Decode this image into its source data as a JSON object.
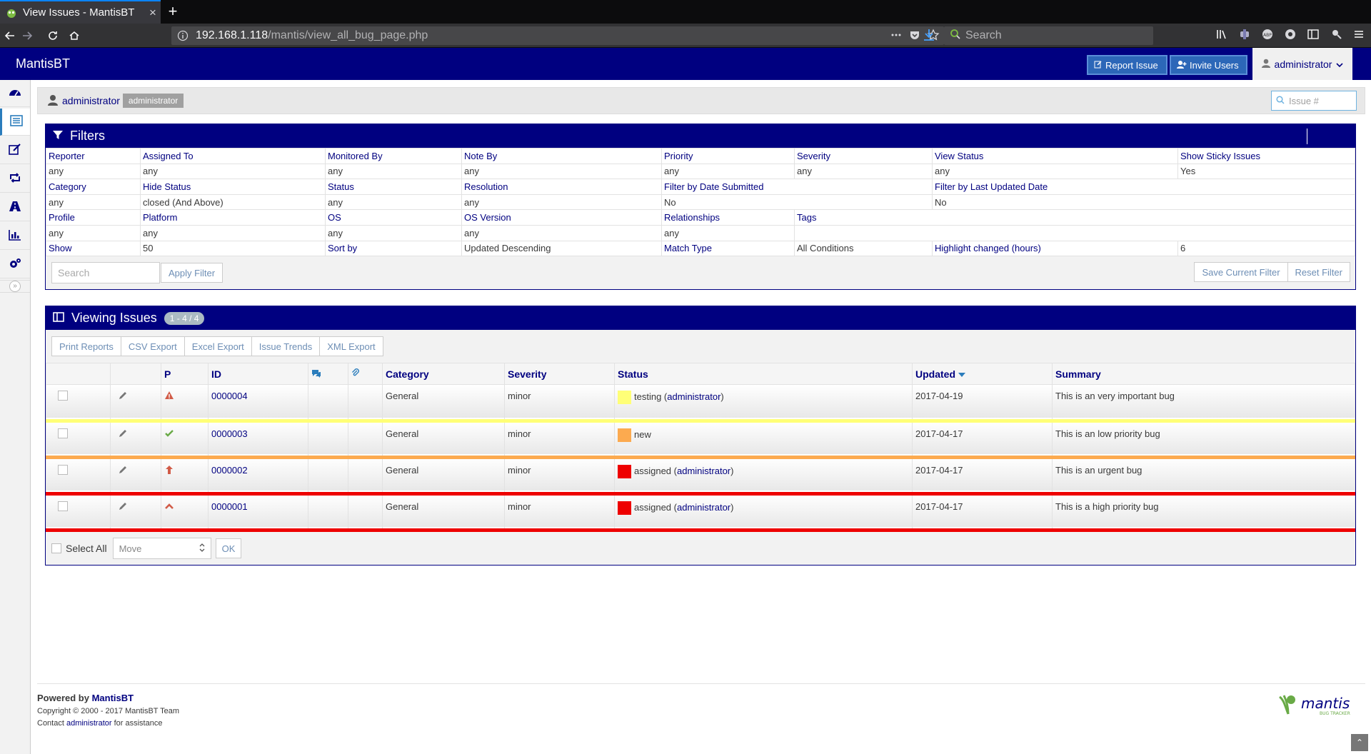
{
  "browser": {
    "tab_title": "View Issues - MantisBT",
    "url_host": "192.168.1.118",
    "url_path": "/mantis/view_all_bug_page.php",
    "search_placeholder": "Search",
    "new_tab": "+",
    "close_tab": "×"
  },
  "nav": {
    "brand": "MantisBT",
    "report_issue": "Report Issue",
    "invite_users": "Invite Users",
    "user": "administrator"
  },
  "breadcrumb": {
    "user": "administrator",
    "role": "administrator",
    "issue_placeholder": "Issue #"
  },
  "filters": {
    "title": "Filters",
    "rows": [
      [
        {
          "t": "Reporter",
          "k": "lbl",
          "c": 1
        },
        {
          "t": "Assigned To",
          "k": "lbl",
          "c": 1
        },
        {
          "t": "Monitored By",
          "k": "lbl",
          "c": 1
        },
        {
          "t": "Note By",
          "k": "lbl",
          "c": 1
        },
        {
          "t": "Priority",
          "k": "lbl",
          "c": 1
        },
        {
          "t": "Severity",
          "k": "lbl",
          "c": 1
        },
        {
          "t": "View Status",
          "k": "lbl",
          "c": 1
        },
        {
          "t": "Show Sticky Issues",
          "k": "lbl",
          "c": 1
        }
      ],
      [
        {
          "t": "any",
          "k": "val",
          "c": 1
        },
        {
          "t": "any",
          "k": "val",
          "c": 1
        },
        {
          "t": "any",
          "k": "val",
          "c": 1
        },
        {
          "t": "any",
          "k": "val",
          "c": 1
        },
        {
          "t": "any",
          "k": "val",
          "c": 1
        },
        {
          "t": "any",
          "k": "val",
          "c": 1
        },
        {
          "t": "any",
          "k": "val",
          "c": 1
        },
        {
          "t": "Yes",
          "k": "val",
          "c": 1
        }
      ],
      [
        {
          "t": "Category",
          "k": "lbl",
          "c": 1
        },
        {
          "t": "Hide Status",
          "k": "lbl",
          "c": 1
        },
        {
          "t": "Status",
          "k": "lbl",
          "c": 1
        },
        {
          "t": "Resolution",
          "k": "lbl",
          "c": 1
        },
        {
          "t": "Filter by Date Submitted",
          "k": "lbl",
          "c": 2
        },
        {
          "t": "Filter by Last Updated Date",
          "k": "lbl",
          "c": 2
        }
      ],
      [
        {
          "t": "any",
          "k": "val",
          "c": 1
        },
        {
          "t": "closed (And Above)",
          "k": "val",
          "c": 1
        },
        {
          "t": "any",
          "k": "val",
          "c": 1
        },
        {
          "t": "any",
          "k": "val",
          "c": 1
        },
        {
          "t": "No",
          "k": "val",
          "c": 2
        },
        {
          "t": "No",
          "k": "val",
          "c": 2
        }
      ],
      [
        {
          "t": "Profile",
          "k": "lbl",
          "c": 1
        },
        {
          "t": "Platform",
          "k": "lbl",
          "c": 1
        },
        {
          "t": "OS",
          "k": "lbl",
          "c": 1
        },
        {
          "t": "OS Version",
          "k": "lbl",
          "c": 1
        },
        {
          "t": "Relationships",
          "k": "lbl",
          "c": 1
        },
        {
          "t": "Tags",
          "k": "lbl",
          "c": 3
        }
      ],
      [
        {
          "t": "any",
          "k": "val",
          "c": 1
        },
        {
          "t": "any",
          "k": "val",
          "c": 1
        },
        {
          "t": "any",
          "k": "val",
          "c": 1
        },
        {
          "t": "any",
          "k": "val",
          "c": 1
        },
        {
          "t": "any",
          "k": "val",
          "c": 1
        },
        {
          "t": "",
          "k": "val",
          "c": 3
        }
      ],
      [
        {
          "t": "Show",
          "k": "lbl",
          "c": 1
        },
        {
          "t": "50",
          "k": "val",
          "c": 1
        },
        {
          "t": "Sort by",
          "k": "lbl",
          "c": 1
        },
        {
          "t": "Updated Descending",
          "k": "val",
          "c": 1
        },
        {
          "t": "Match Type",
          "k": "lbl",
          "c": 1
        },
        {
          "t": "All Conditions",
          "k": "val",
          "c": 1
        },
        {
          "t": "Highlight changed (hours)",
          "k": "lbl",
          "c": 1
        },
        {
          "t": "6",
          "k": "val",
          "c": 1
        }
      ]
    ],
    "search_placeholder": "Search",
    "apply": "Apply Filter",
    "save": "Save Current Filter",
    "reset": "Reset Filter"
  },
  "issues": {
    "title": "Viewing Issues",
    "count": "1 - 4 / 4",
    "exports": [
      "Print Reports",
      "CSV Export",
      "Excel Export",
      "Issue Trends",
      "XML Export"
    ],
    "columns": {
      "priority": "P",
      "id": "ID",
      "category": "Category",
      "severity": "Severity",
      "status": "Status",
      "updated": "Updated",
      "summary": "Summary"
    },
    "rows": [
      {
        "id": "0000004",
        "priority_icon": "warning-icon",
        "priority_color": "#d15b47",
        "category": "General",
        "severity": "minor",
        "status": "testing",
        "handler": "administrator",
        "status_color": "#ffff77",
        "updated": "2017-04-19",
        "summary": "This is an very important bug"
      },
      {
        "id": "0000003",
        "priority_icon": "check-icon",
        "priority_color": "#69aa46",
        "category": "General",
        "severity": "minor",
        "status": "new",
        "handler": "",
        "status_color": "#fcaa4f",
        "updated": "2017-04-17",
        "summary": "This is an low priority bug"
      },
      {
        "id": "0000002",
        "priority_icon": "arrow-up-icon",
        "priority_color": "#d15b47",
        "category": "General",
        "severity": "minor",
        "status": "assigned",
        "handler": "administrator",
        "status_color": "#ee0000",
        "updated": "2017-04-17",
        "summary": "This is an urgent bug"
      },
      {
        "id": "0000001",
        "priority_icon": "chevron-up-icon",
        "priority_color": "#d15b47",
        "category": "General",
        "severity": "minor",
        "status": "assigned",
        "handler": "administrator",
        "status_color": "#ee0000",
        "updated": "2017-04-17",
        "summary": "This is a high priority bug"
      }
    ],
    "select_all": "Select All",
    "move": "Move",
    "ok": "OK"
  },
  "footer": {
    "powered_prefix": "Powered by ",
    "powered_link": "MantisBT",
    "copyright": "Copyright © 2000 - 2017 MantisBT Team",
    "contact_prefix": "Contact ",
    "contact_link": "administrator",
    "contact_suffix": " for assistance",
    "logo_text": "mantis",
    "logo_sub": "BUG TRACKER"
  },
  "colors": {
    "brand_navy": "#000080",
    "button_blue": "#2c67b8"
  }
}
